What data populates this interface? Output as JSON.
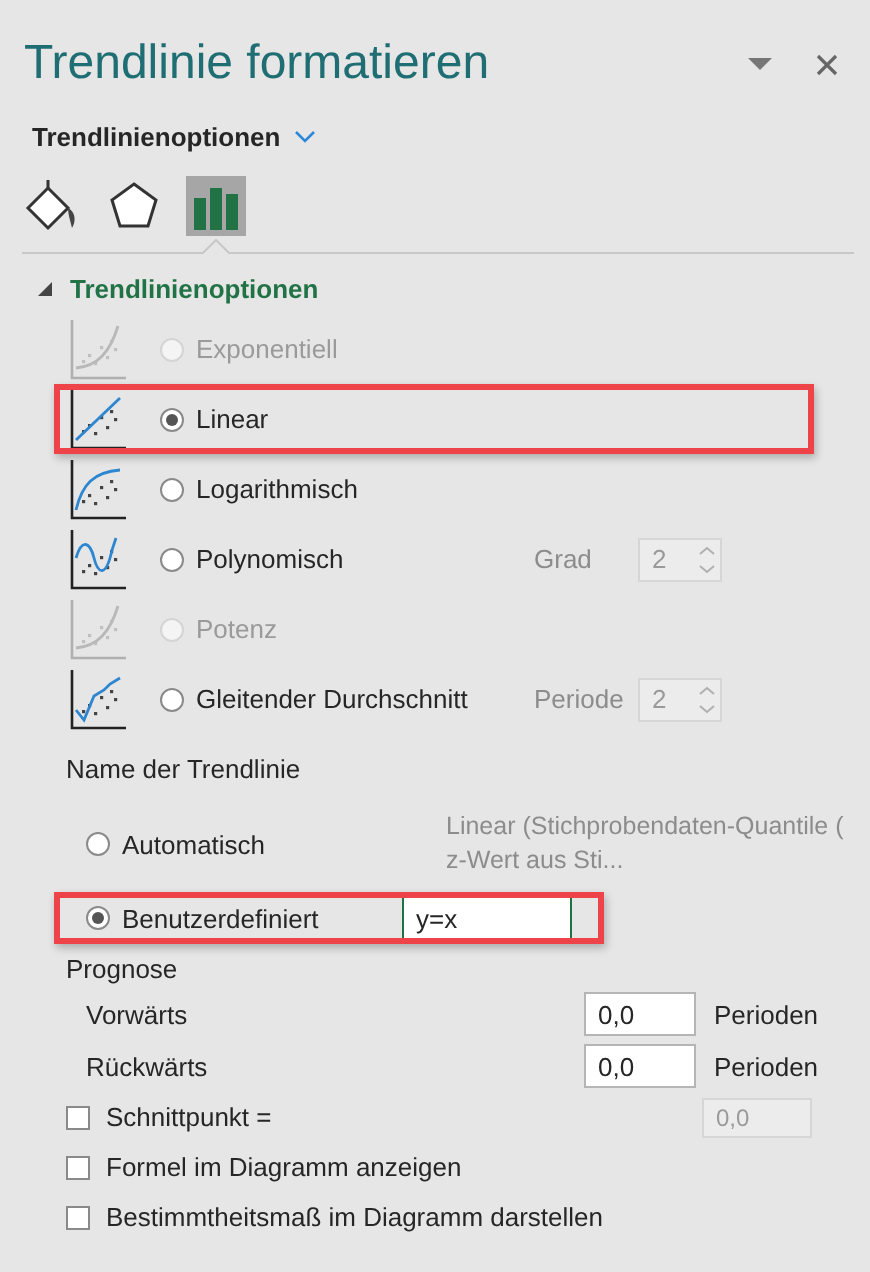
{
  "pane": {
    "title": "Trendlinie formatieren",
    "dropdown": "Trendlinienoptionen"
  },
  "icon_tabs": [
    {
      "kind": "fill",
      "selected": false
    },
    {
      "kind": "shape",
      "selected": false
    },
    {
      "kind": "chart",
      "selected": true
    }
  ],
  "section": {
    "title": "Trendlinienoptionen",
    "expanded": true
  },
  "types": [
    {
      "kind": "exponential",
      "label": "Exponentiell",
      "selected": false,
      "disabled": true,
      "highlighted": false
    },
    {
      "kind": "linear",
      "label": "Linear",
      "selected": true,
      "disabled": false,
      "highlighted": true
    },
    {
      "kind": "logarithmic",
      "label": "Logarithmisch",
      "selected": false,
      "disabled": false,
      "highlighted": false
    },
    {
      "kind": "polynomial",
      "label": "Polynomisch",
      "selected": false,
      "disabled": false,
      "highlighted": false,
      "param": {
        "label": "Grad",
        "value": "2"
      }
    },
    {
      "kind": "power",
      "label": "Potenz",
      "selected": false,
      "disabled": true,
      "highlighted": false
    },
    {
      "kind": "moving",
      "label": "Gleitender Durchschnitt",
      "selected": false,
      "disabled": false,
      "highlighted": false,
      "param": {
        "label": "Periode",
        "value": "2"
      }
    }
  ],
  "name": {
    "heading": "Name der Trendlinie",
    "options": [
      {
        "kind": "auto",
        "label": "Automatisch",
        "selected": false,
        "highlighted": false,
        "text": "Linear (Stichprobendaten-Quantile ( z-Wert aus Sti..."
      },
      {
        "kind": "custom",
        "label": "Benutzerdefiniert",
        "selected": true,
        "highlighted": true,
        "value": "y=x"
      }
    ]
  },
  "forecast": {
    "heading": "Prognose",
    "rows": [
      {
        "label": "Vorwärts",
        "value": "0,0",
        "unit": "Perioden"
      },
      {
        "label": "Rückwärts",
        "value": "0,0",
        "unit": "Perioden"
      }
    ]
  },
  "checkboxes": [
    {
      "label": "Schnittpunkt =",
      "checked": false,
      "value": "0,0"
    },
    {
      "label": "Formel im Diagramm anzeigen",
      "checked": false
    },
    {
      "label": "Bestimmtheitsmaß im Diagramm darstellen",
      "checked": false
    }
  ]
}
